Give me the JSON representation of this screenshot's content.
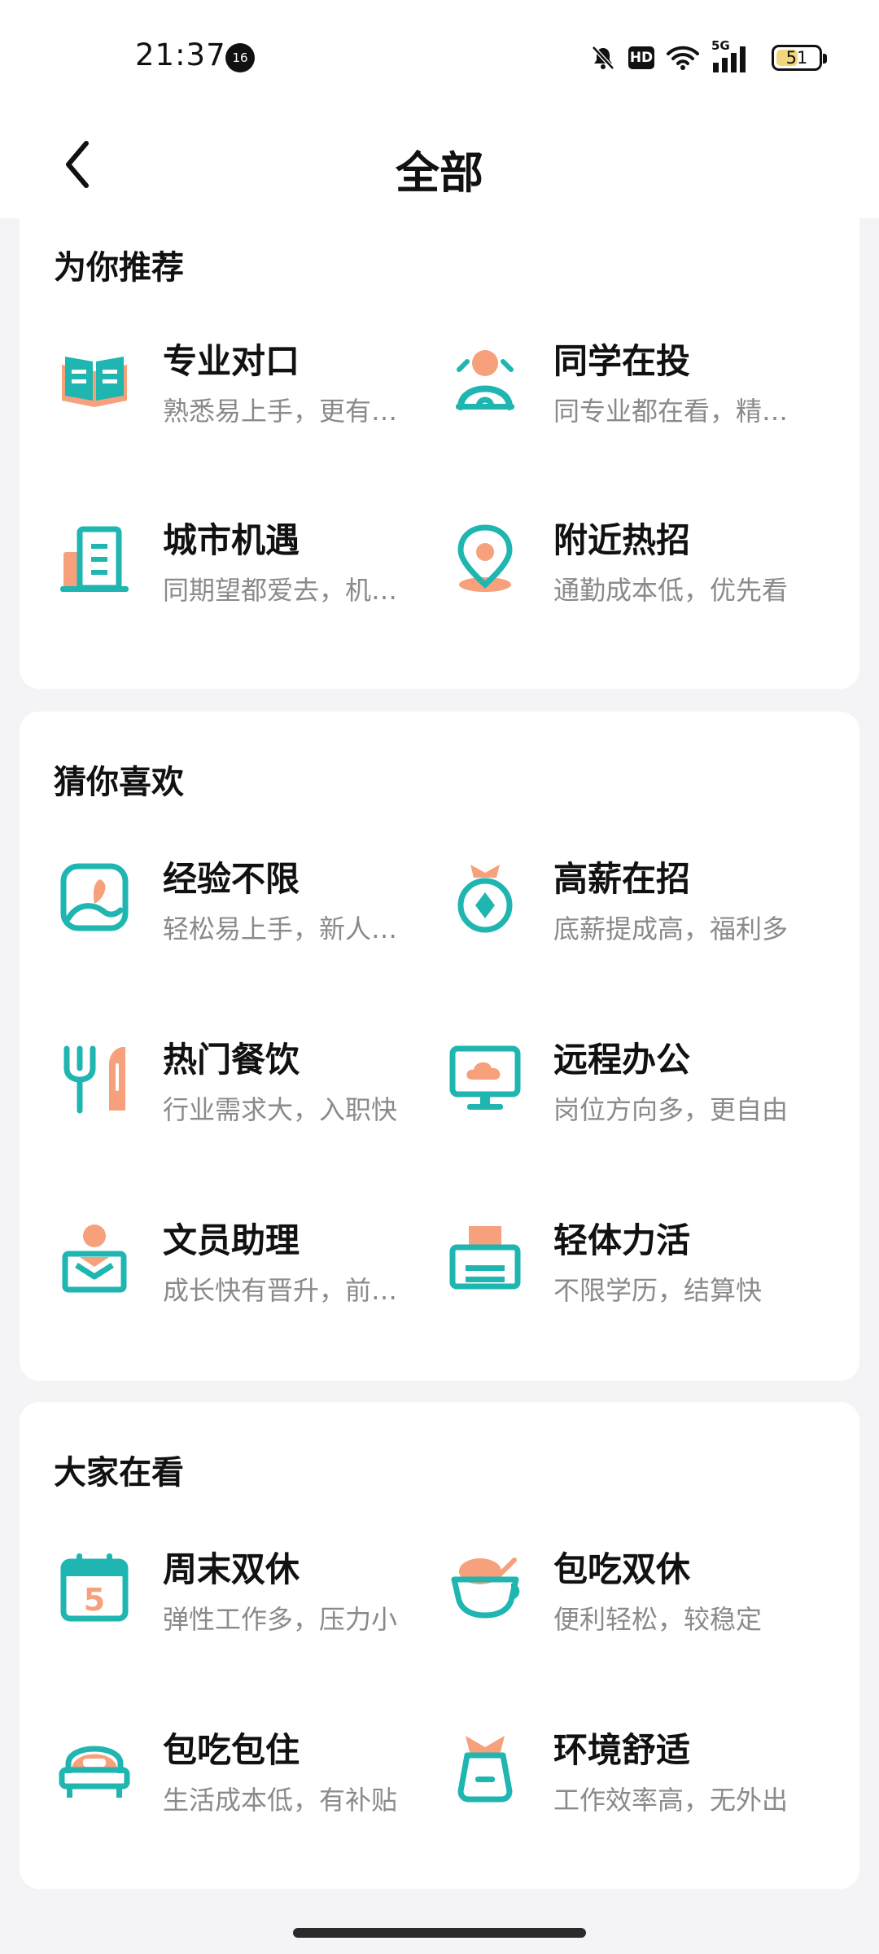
{
  "status_bar": {
    "time": "21:37",
    "notification_badge": "16",
    "battery": "51",
    "network": "5G",
    "hd_label": "HD"
  },
  "header": {
    "title": "全部"
  },
  "sections": [
    {
      "title": "为你推荐",
      "items": [
        {
          "title": "专业对口",
          "subtitle": "熟悉易上手，更有…",
          "icon": "book-icon"
        },
        {
          "title": "同学在投",
          "subtitle": "同专业都在看，精…",
          "icon": "classmate-icon"
        },
        {
          "title": "城市机遇",
          "subtitle": "同期望都爱去，机…",
          "icon": "building-icon"
        },
        {
          "title": "附近热招",
          "subtitle": "通勤成本低，优先看",
          "icon": "nearby-location-icon"
        }
      ]
    },
    {
      "title": "猜你喜欢",
      "items": [
        {
          "title": "经验不限",
          "subtitle": "轻松易上手，新人…",
          "icon": "experience-icon"
        },
        {
          "title": "高薪在招",
          "subtitle": "底薪提成高，福利多",
          "icon": "money-bag-icon"
        },
        {
          "title": "热门餐饮",
          "subtitle": "行业需求大，入职快",
          "icon": "fork-icon"
        },
        {
          "title": "远程办公",
          "subtitle": "岗位方向多，更自由",
          "icon": "monitor-cloud-icon"
        },
        {
          "title": "文员助理",
          "subtitle": "成长快有晋升，前…",
          "icon": "clerk-icon"
        },
        {
          "title": "轻体力活",
          "subtitle": "不限学历，结算快",
          "icon": "printer-icon"
        }
      ]
    },
    {
      "title": "大家在看",
      "items": [
        {
          "title": "周末双休",
          "subtitle": "弹性工作多，压力小",
          "icon": "calendar-icon",
          "calendar_day": "5"
        },
        {
          "title": "包吃双休",
          "subtitle": "便利轻松，较稳定",
          "icon": "food-bowl-icon"
        },
        {
          "title": "包吃包住",
          "subtitle": "生活成本低，有补贴",
          "icon": "bed-icon"
        },
        {
          "title": "环境舒适",
          "subtitle": "工作效率高，无外出",
          "icon": "bag-icon"
        }
      ]
    }
  ],
  "colors": {
    "teal": "#1fb5b0",
    "orange": "#f6a07c",
    "background": "#f4f4f6"
  }
}
